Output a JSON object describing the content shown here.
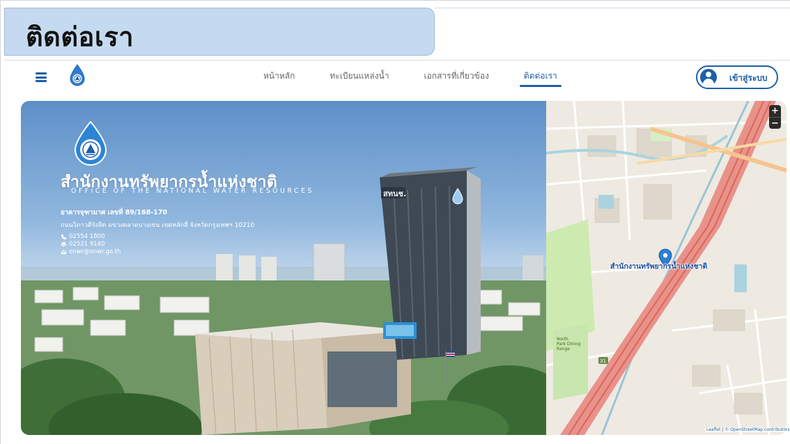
{
  "page": {
    "title": "ติดต่อเรา"
  },
  "nav": {
    "links": [
      {
        "label": "หน้าหลัก",
        "active": false
      },
      {
        "label": "ทะเบียนแหล่งน้ำ",
        "active": false
      },
      {
        "label": "เอกสารที่เกี่ยวข้อง",
        "active": false
      },
      {
        "label": "ติดต่อเรา",
        "active": true
      }
    ],
    "login_label": "เข้าสู่ระบบ",
    "menu_icon": "hamburger-icon",
    "accent_color": "#1e5fa8"
  },
  "org": {
    "name_th": "สำนักงานทรัพยากรน้ำแห่งชาติ",
    "name_en": "OFFICE OF THE NATIONAL WATER RESOURCES",
    "address_line1": "อาคารจุฑามาศ เลขที่ 89/168-170",
    "address_line2": "ถนนวิภาวดีรังสิต แขวงตลาดบางเขน เขตหลักสี่ จังหวัดกรุงเทพฯ 10210",
    "phone": "02554 1800",
    "fax": "02521 9140",
    "email": "onwr@onwr.go.th",
    "building_sign": "สทนช."
  },
  "map": {
    "zoom_in": "+",
    "zoom_out": "−",
    "marker_label": "สำนักงานทรัพยากรน้ำแห่งชาติ",
    "attribution_leaflet": "Leaflet",
    "attribution_osm": "© OpenStreetMap contributors",
    "attribution_sep": " | ",
    "poi_park": "North Park Dining Range",
    "road_number": "31"
  }
}
